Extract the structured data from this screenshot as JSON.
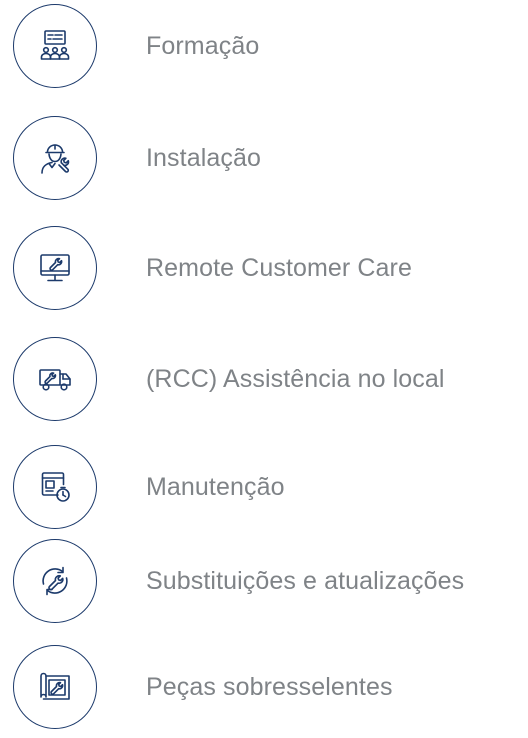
{
  "colors": {
    "icon_stroke": "#1c3a6b",
    "label_text": "#7f8387",
    "background": "#ffffff"
  },
  "services": [
    {
      "label": "Formação",
      "icon": "training-presentation-icon"
    },
    {
      "label": "Instalação",
      "icon": "technician-wrench-icon"
    },
    {
      "label": "Remote Customer Care",
      "icon": "monitor-wrench-icon"
    },
    {
      "label": "(RCC) Assistência no local",
      "icon": "service-truck-icon"
    },
    {
      "label": "Manutenção",
      "icon": "maintenance-timer-icon"
    },
    {
      "label": "Substituições e atualizações",
      "icon": "circular-arrows-wrench-icon"
    },
    {
      "label": "Peças sobresselentes",
      "icon": "blueprint-wrench-icon"
    }
  ]
}
